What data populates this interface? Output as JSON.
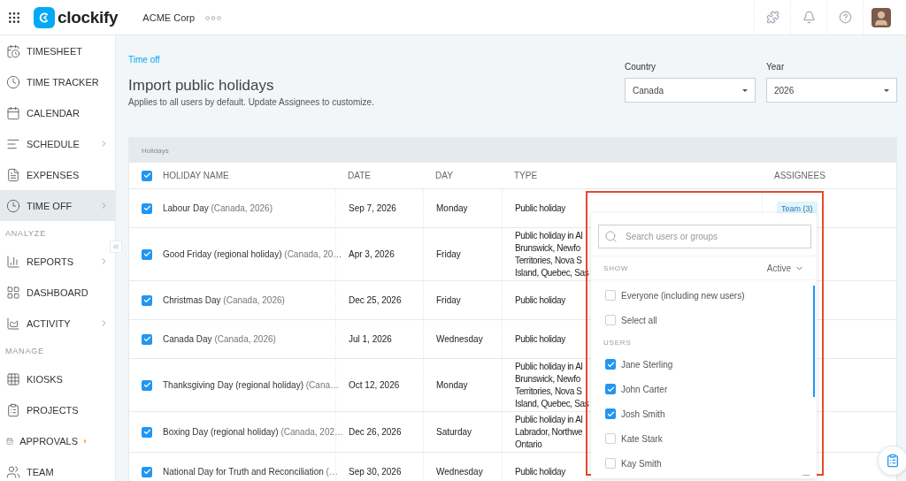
{
  "topbar": {
    "logo_text": "clockify",
    "workspace": "ACME Corp"
  },
  "sidebar": {
    "items": [
      {
        "kind": "item",
        "label": "TIMESHEET",
        "selected": false,
        "submenu": false,
        "notification": false
      },
      {
        "kind": "item",
        "label": "TIME TRACKER",
        "selected": false,
        "submenu": false,
        "notification": false
      },
      {
        "kind": "item",
        "label": "CALENDAR",
        "selected": false,
        "submenu": false,
        "notification": false
      },
      {
        "kind": "item",
        "label": "SCHEDULE",
        "selected": false,
        "submenu": true,
        "notification": false
      },
      {
        "kind": "item",
        "label": "EXPENSES",
        "selected": false,
        "submenu": false,
        "notification": false
      },
      {
        "kind": "item",
        "label": "TIME OFF",
        "selected": true,
        "submenu": true,
        "notification": false
      },
      {
        "kind": "section",
        "label": "ANALYZE"
      },
      {
        "kind": "item",
        "label": "REPORTS",
        "selected": false,
        "submenu": true,
        "notification": false
      },
      {
        "kind": "item",
        "label": "DASHBOARD",
        "selected": false,
        "submenu": false,
        "notification": false
      },
      {
        "kind": "item",
        "label": "ACTIVITY",
        "selected": false,
        "submenu": true,
        "notification": false
      },
      {
        "kind": "section",
        "label": "MANAGE"
      },
      {
        "kind": "item",
        "label": "KIOSKS",
        "selected": false,
        "submenu": false,
        "notification": false
      },
      {
        "kind": "item",
        "label": "PROJECTS",
        "selected": false,
        "submenu": false,
        "notification": false
      },
      {
        "kind": "item",
        "label": "APPROVALS",
        "selected": false,
        "submenu": false,
        "notification": true
      },
      {
        "kind": "item",
        "label": "TEAM",
        "selected": false,
        "submenu": false,
        "notification": false
      }
    ]
  },
  "page": {
    "breadcrumb": "Time off",
    "title": "Import public holidays",
    "subtitle": "Applies to all users by default. Update Assignees to customize.",
    "filters": [
      {
        "label": "Country",
        "value": "Canada"
      },
      {
        "label": "Year",
        "value": "2026"
      }
    ]
  },
  "table": {
    "caption": "Holidays",
    "all_checked": true,
    "columns": [
      "HOLIDAY NAME",
      "DATE",
      "DAY",
      "TYPE",
      "ASSIGNEES"
    ],
    "rows": [
      {
        "checked": true,
        "name": "Labour Day",
        "detail": "(Canada, 2026)",
        "date": "Sep 7, 2026",
        "day": "Monday",
        "type": "Public holiday",
        "assignees": "Team (3)"
      },
      {
        "checked": true,
        "name": "Good Friday (regional holiday)",
        "detail": "(Canada, 20…",
        "date": "Apr 3, 2026",
        "day": "Friday",
        "type": "Public holiday in Al\nBrunswick, Newfo\nTerritories, Nova S\nIsland, Quebec, Sas"
      },
      {
        "checked": true,
        "name": "Christmas Day",
        "detail": "(Canada, 2026)",
        "date": "Dec 25, 2026",
        "day": "Friday",
        "type": "Public holiday"
      },
      {
        "checked": true,
        "name": "Canada Day",
        "detail": "(Canada, 2026)",
        "date": "Jul 1, 2026",
        "day": "Wednesday",
        "type": "Public holiday"
      },
      {
        "checked": true,
        "name": "Thanksgiving Day (regional holiday)",
        "detail": "(Cana…",
        "date": "Oct 12, 2026",
        "day": "Monday",
        "type": "Public holiday in Al\nBrunswick, Newfo\nTerritories, Nova S\nIsland, Quebec, Sas"
      },
      {
        "checked": true,
        "name": "Boxing Day (regional holiday)",
        "detail": "(Canada, 202…",
        "date": "Dec 26, 2026",
        "day": "Saturday",
        "type": "Public holiday in Al\nLabrador, Northwe\nOntario"
      },
      {
        "checked": true,
        "name": "National Day for Truth and Reconciliation",
        "detail": "(…",
        "date": "Sep 30, 2026",
        "day": "Wednesday",
        "type": "Public holiday"
      }
    ]
  },
  "assignee_dropdown": {
    "search_placeholder": "Search users or groups",
    "show_label": "SHOW",
    "show_value": "Active",
    "options": [
      {
        "label": "Everyone (including new users)",
        "checked": false
      },
      {
        "label": "Select all",
        "checked": false
      }
    ],
    "users_label": "USERS",
    "users": [
      {
        "label": "Jane Sterling",
        "checked": true
      },
      {
        "label": "John Carter",
        "checked": true
      },
      {
        "label": "Josh Smith",
        "checked": true
      },
      {
        "label": "Kate Stark",
        "checked": false
      },
      {
        "label": "Kay Smith",
        "checked": false
      }
    ]
  }
}
